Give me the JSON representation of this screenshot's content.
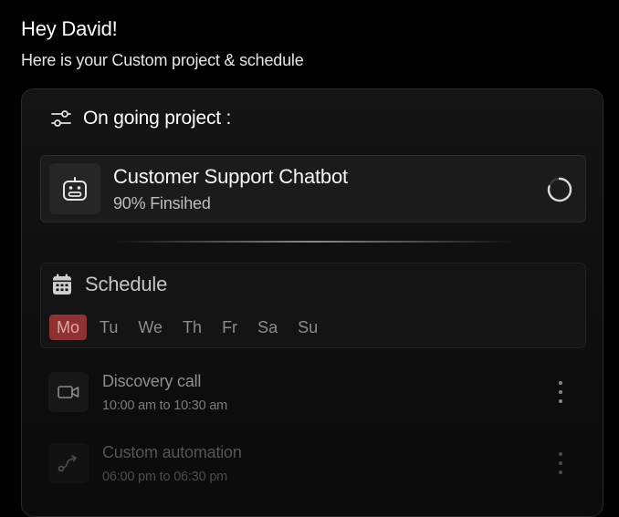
{
  "greeting": {
    "title": "Hey David!",
    "subtitle": "Here is your Custom project & schedule"
  },
  "ongoing": {
    "heading": "On going project :",
    "icon": "sliders-icon",
    "project": {
      "name": "Customer Support Chatbot",
      "progress_text": "90% Finsihed",
      "icon": "robot-icon",
      "status_icon": "loading-spinner-icon"
    }
  },
  "schedule": {
    "title": "Schedule",
    "icon": "calendar-icon",
    "days": [
      "Mo",
      "Tu",
      "We",
      "Th",
      "Fr",
      "Sa",
      "Su"
    ],
    "active_day": "Mo",
    "events": [
      {
        "title": "Discovery call",
        "time": "10:00 am to  10:30 am",
        "icon": "video-camera-icon"
      },
      {
        "title": "Custom automation",
        "time": "06:00 pm to  06:30 pm",
        "icon": "route-icon"
      }
    ]
  },
  "colors": {
    "background": "#000000",
    "card": "#141414",
    "accent_active_day": "#8f3234"
  }
}
